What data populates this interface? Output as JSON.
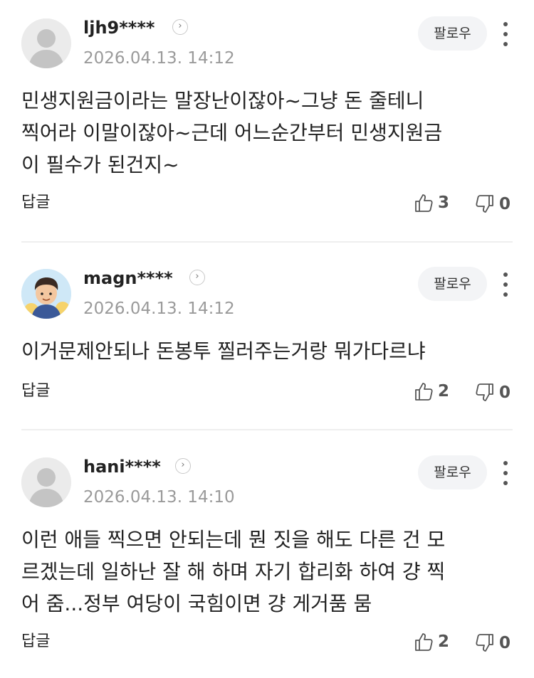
{
  "follow_label": "팔로우",
  "reply_label": "답글",
  "comments": [
    {
      "nickname": "ljh9****",
      "date": "2026.04.13. 14:12",
      "lines": [
        "민생지원금이라는 말장난이잖아~그냥 돈 줄테니",
        "찍어라 이말이잖아~근데 어느순간부터 민생지원금",
        "이 필수가 된건지~"
      ],
      "likes": "3",
      "dislikes": "0",
      "avatar": "default-avatar"
    },
    {
      "nickname": "magn****",
      "date": "2026.04.13. 14:12",
      "lines": [
        "이거문제안되나 돈봉투 찔러주는거랑 뭐가다르냐"
      ],
      "likes": "2",
      "dislikes": "0",
      "avatar": "cartoon-avatar"
    },
    {
      "nickname": "hani****",
      "date": "2026.04.13. 14:10",
      "lines": [
        "이런 애들 찍으면 안되는데 뭔 짓을 해도 다른 건 모",
        "르겠는데 일하난 잘 해 하며 자기 합리화 하여 걍 찍",
        "어 줌...정부 여당이 국힘이면 걍 게거품 뭄"
      ],
      "likes": "2",
      "dislikes": "0",
      "avatar": "default-avatar"
    }
  ]
}
